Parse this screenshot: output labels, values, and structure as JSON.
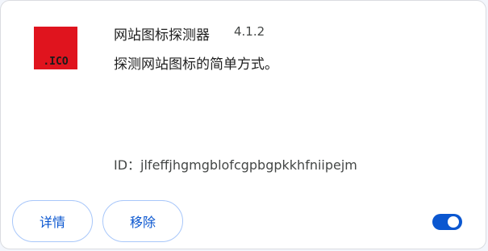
{
  "extension": {
    "icon_text": ".ICO",
    "icon_color": "#e0141e",
    "name": "网站图标探测器",
    "version": "4.1.2",
    "description": "探测网站图标的简单方式。",
    "id_label": "ID：jlfeffjhgmgblofcgpbgpkkhfniipejm"
  },
  "actions": {
    "details_label": "详情",
    "remove_label": "移除"
  },
  "toggle": {
    "enabled": true,
    "accent_color": "#0b57d0"
  }
}
